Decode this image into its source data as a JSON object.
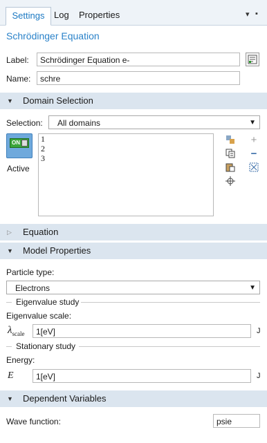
{
  "tabs": [
    {
      "label": "Settings",
      "active": true
    },
    {
      "label": "Log",
      "active": false
    },
    {
      "label": "Properties",
      "active": false
    }
  ],
  "toolbar": {
    "pin_icon": "pin-icon",
    "menu_icon": "dropdown-menu-icon"
  },
  "page_title": "Schrödinger Equation",
  "label_field": {
    "label": "Label:",
    "value": "Schrödinger Equation e-"
  },
  "name_field": {
    "label": "Name:",
    "value": "schre"
  },
  "domain_selection": {
    "header": "Domain Selection",
    "selection_label": "Selection:",
    "selection_value": "All domains",
    "toggle_text": "ON",
    "active_label": "Active",
    "domains": [
      "1",
      "2",
      "3"
    ]
  },
  "equation": {
    "header": "Equation"
  },
  "model_properties": {
    "header": "Model Properties",
    "particle_type_label": "Particle type:",
    "particle_type_value": "Electrons",
    "eigen_group": "Eigenvalue study",
    "eigen_scale_label": "Eigenvalue scale:",
    "lambda_symbol": "λ",
    "lambda_sub": "scale",
    "lambda_value": "1[eV]",
    "lambda_unit": "J",
    "stationary_group": "Stationary study",
    "energy_label": "Energy:",
    "energy_symbol": "E",
    "energy_value": "1[eV]",
    "energy_unit": "J"
  },
  "dependent_variables": {
    "header": "Dependent Variables",
    "wave_label": "Wave function:",
    "wave_value": "psie"
  },
  "colors": {
    "accent": "#2a82c9",
    "section_bg": "#dbe5ef"
  }
}
